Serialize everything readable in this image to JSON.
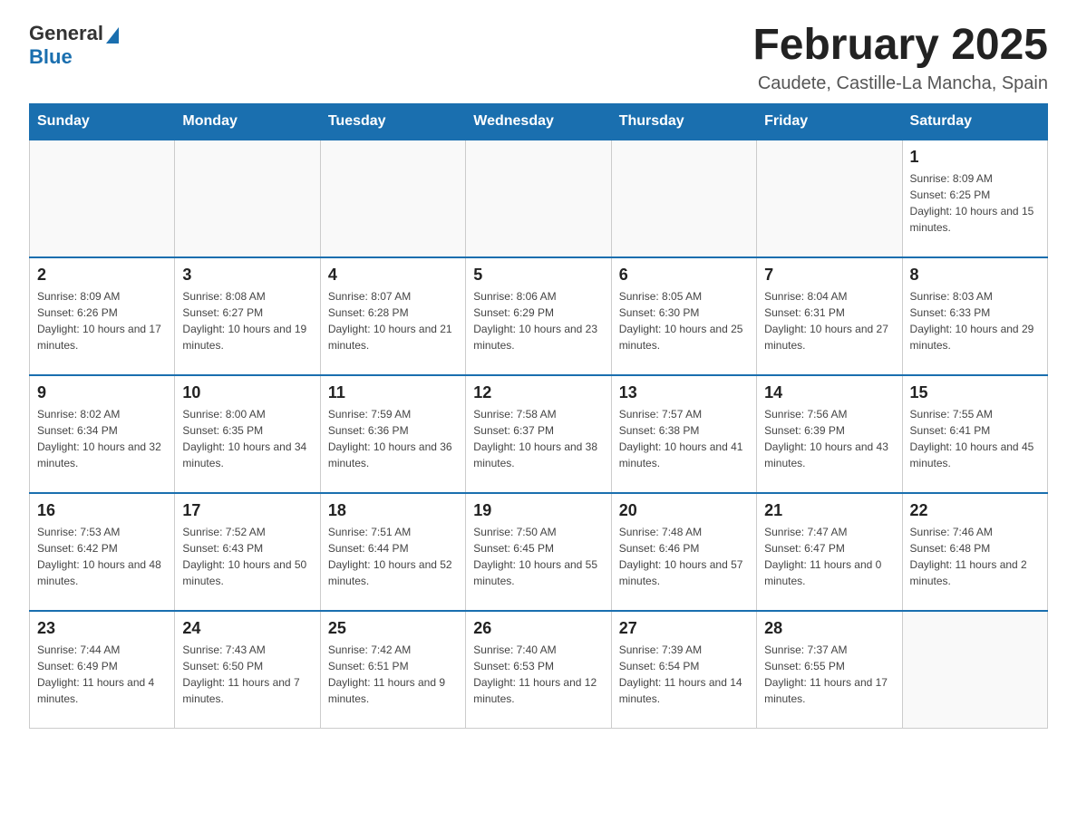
{
  "logo": {
    "general": "General",
    "blue": "Blue"
  },
  "title": "February 2025",
  "subtitle": "Caudete, Castille-La Mancha, Spain",
  "days_of_week": [
    "Sunday",
    "Monday",
    "Tuesday",
    "Wednesday",
    "Thursday",
    "Friday",
    "Saturday"
  ],
  "weeks": [
    [
      {
        "day": "",
        "info": ""
      },
      {
        "day": "",
        "info": ""
      },
      {
        "day": "",
        "info": ""
      },
      {
        "day": "",
        "info": ""
      },
      {
        "day": "",
        "info": ""
      },
      {
        "day": "",
        "info": ""
      },
      {
        "day": "1",
        "info": "Sunrise: 8:09 AM\nSunset: 6:25 PM\nDaylight: 10 hours and 15 minutes."
      }
    ],
    [
      {
        "day": "2",
        "info": "Sunrise: 8:09 AM\nSunset: 6:26 PM\nDaylight: 10 hours and 17 minutes."
      },
      {
        "day": "3",
        "info": "Sunrise: 8:08 AM\nSunset: 6:27 PM\nDaylight: 10 hours and 19 minutes."
      },
      {
        "day": "4",
        "info": "Sunrise: 8:07 AM\nSunset: 6:28 PM\nDaylight: 10 hours and 21 minutes."
      },
      {
        "day": "5",
        "info": "Sunrise: 8:06 AM\nSunset: 6:29 PM\nDaylight: 10 hours and 23 minutes."
      },
      {
        "day": "6",
        "info": "Sunrise: 8:05 AM\nSunset: 6:30 PM\nDaylight: 10 hours and 25 minutes."
      },
      {
        "day": "7",
        "info": "Sunrise: 8:04 AM\nSunset: 6:31 PM\nDaylight: 10 hours and 27 minutes."
      },
      {
        "day": "8",
        "info": "Sunrise: 8:03 AM\nSunset: 6:33 PM\nDaylight: 10 hours and 29 minutes."
      }
    ],
    [
      {
        "day": "9",
        "info": "Sunrise: 8:02 AM\nSunset: 6:34 PM\nDaylight: 10 hours and 32 minutes."
      },
      {
        "day": "10",
        "info": "Sunrise: 8:00 AM\nSunset: 6:35 PM\nDaylight: 10 hours and 34 minutes."
      },
      {
        "day": "11",
        "info": "Sunrise: 7:59 AM\nSunset: 6:36 PM\nDaylight: 10 hours and 36 minutes."
      },
      {
        "day": "12",
        "info": "Sunrise: 7:58 AM\nSunset: 6:37 PM\nDaylight: 10 hours and 38 minutes."
      },
      {
        "day": "13",
        "info": "Sunrise: 7:57 AM\nSunset: 6:38 PM\nDaylight: 10 hours and 41 minutes."
      },
      {
        "day": "14",
        "info": "Sunrise: 7:56 AM\nSunset: 6:39 PM\nDaylight: 10 hours and 43 minutes."
      },
      {
        "day": "15",
        "info": "Sunrise: 7:55 AM\nSunset: 6:41 PM\nDaylight: 10 hours and 45 minutes."
      }
    ],
    [
      {
        "day": "16",
        "info": "Sunrise: 7:53 AM\nSunset: 6:42 PM\nDaylight: 10 hours and 48 minutes."
      },
      {
        "day": "17",
        "info": "Sunrise: 7:52 AM\nSunset: 6:43 PM\nDaylight: 10 hours and 50 minutes."
      },
      {
        "day": "18",
        "info": "Sunrise: 7:51 AM\nSunset: 6:44 PM\nDaylight: 10 hours and 52 minutes."
      },
      {
        "day": "19",
        "info": "Sunrise: 7:50 AM\nSunset: 6:45 PM\nDaylight: 10 hours and 55 minutes."
      },
      {
        "day": "20",
        "info": "Sunrise: 7:48 AM\nSunset: 6:46 PM\nDaylight: 10 hours and 57 minutes."
      },
      {
        "day": "21",
        "info": "Sunrise: 7:47 AM\nSunset: 6:47 PM\nDaylight: 11 hours and 0 minutes."
      },
      {
        "day": "22",
        "info": "Sunrise: 7:46 AM\nSunset: 6:48 PM\nDaylight: 11 hours and 2 minutes."
      }
    ],
    [
      {
        "day": "23",
        "info": "Sunrise: 7:44 AM\nSunset: 6:49 PM\nDaylight: 11 hours and 4 minutes."
      },
      {
        "day": "24",
        "info": "Sunrise: 7:43 AM\nSunset: 6:50 PM\nDaylight: 11 hours and 7 minutes."
      },
      {
        "day": "25",
        "info": "Sunrise: 7:42 AM\nSunset: 6:51 PM\nDaylight: 11 hours and 9 minutes."
      },
      {
        "day": "26",
        "info": "Sunrise: 7:40 AM\nSunset: 6:53 PM\nDaylight: 11 hours and 12 minutes."
      },
      {
        "day": "27",
        "info": "Sunrise: 7:39 AM\nSunset: 6:54 PM\nDaylight: 11 hours and 14 minutes."
      },
      {
        "day": "28",
        "info": "Sunrise: 7:37 AM\nSunset: 6:55 PM\nDaylight: 11 hours and 17 minutes."
      },
      {
        "day": "",
        "info": ""
      }
    ]
  ]
}
